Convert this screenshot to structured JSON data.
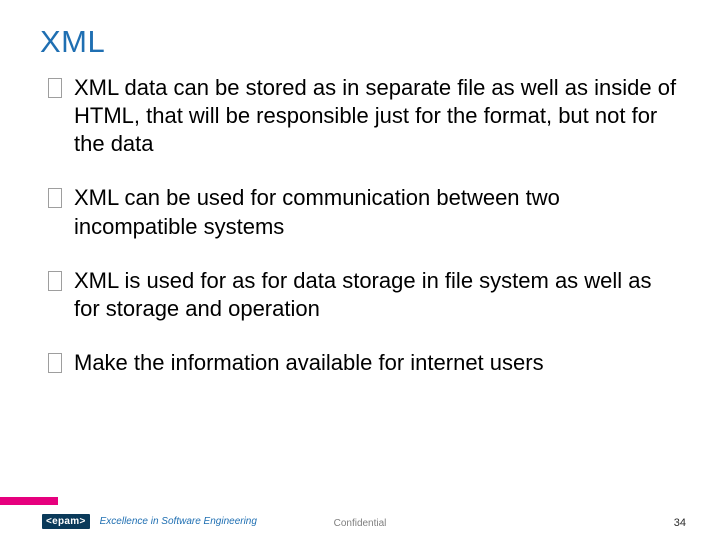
{
  "title": "XML",
  "bullets": [
    "XML data can be stored as in separate file as well as inside of HTML, that will be responsible just for the format, but not for the data",
    "XML can be used for communication between two incompatible systems",
    "XML is used for as for data storage in file system as well as for storage and operation",
    "Make the information available for internet users"
  ],
  "footer": {
    "logo_text": "<epam>",
    "tagline": "Excellence in Software Engineering",
    "confidential": "Confidential",
    "page_number": "34"
  }
}
